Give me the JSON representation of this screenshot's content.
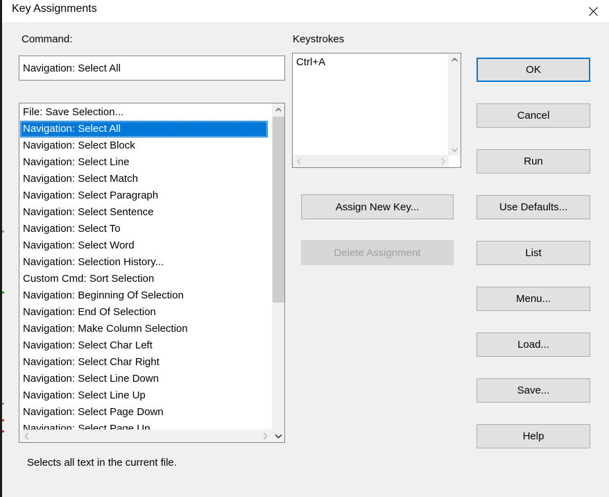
{
  "window": {
    "title": "Key Assignments",
    "close_icon": "close-icon"
  },
  "command_section": {
    "label": "Command:",
    "input_value": "Navigation: Select All",
    "input_placeholder": ""
  },
  "keystrokes_section": {
    "label": "Keystrokes",
    "items": [
      "Ctrl+A"
    ]
  },
  "command_list": {
    "items": [
      {
        "label": "File: Save Selection...",
        "selected": false
      },
      {
        "label": "Navigation: Select All",
        "selected": true
      },
      {
        "label": "Navigation: Select Block",
        "selected": false
      },
      {
        "label": "Navigation: Select Line",
        "selected": false
      },
      {
        "label": "Navigation: Select Match",
        "selected": false
      },
      {
        "label": "Navigation: Select Paragraph",
        "selected": false
      },
      {
        "label": "Navigation: Select Sentence",
        "selected": false
      },
      {
        "label": "Navigation: Select To",
        "selected": false
      },
      {
        "label": "Navigation: Select Word",
        "selected": false
      },
      {
        "label": "Navigation: Selection History...",
        "selected": false
      },
      {
        "label": "Custom Cmd: Sort Selection",
        "selected": false
      },
      {
        "label": "Navigation: Beginning Of Selection",
        "selected": false
      },
      {
        "label": "Navigation: End Of Selection",
        "selected": false
      },
      {
        "label": "Navigation: Make Column Selection",
        "selected": false
      },
      {
        "label": "Navigation: Select Char Left",
        "selected": false
      },
      {
        "label": "Navigation: Select Char Right",
        "selected": false
      },
      {
        "label": "Navigation: Select Line Down",
        "selected": false
      },
      {
        "label": "Navigation: Select Line Up",
        "selected": false
      },
      {
        "label": "Navigation: Select Page Down",
        "selected": false
      },
      {
        "label": "Navigation: Select Page Up",
        "selected": false
      }
    ]
  },
  "middle_buttons": {
    "assign_new_key": "Assign New Key...",
    "delete_assignment": "Delete Assignment"
  },
  "right_buttons": [
    {
      "label": "OK",
      "default": true
    },
    {
      "label": "Cancel",
      "default": false
    },
    {
      "label": "Run",
      "default": false
    },
    {
      "label": "Use Defaults...",
      "default": false
    },
    {
      "label": "List",
      "default": false
    },
    {
      "label": "Menu...",
      "default": false
    },
    {
      "label": "Load...",
      "default": false
    },
    {
      "label": "Save...",
      "default": false
    },
    {
      "label": "Help",
      "default": false
    }
  ],
  "status": {
    "text": "Selects all text in the current file."
  },
  "colors": {
    "dialog_background": "#f0f0f0",
    "selection_blue": "#0078d7",
    "button_face": "#e1e1e1",
    "field_white": "#ffffff"
  }
}
